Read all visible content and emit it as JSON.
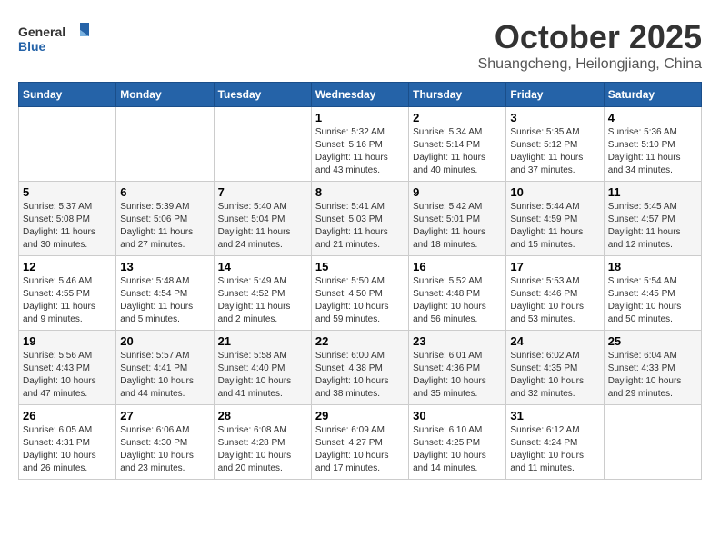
{
  "header": {
    "logo_line1": "General",
    "logo_line2": "Blue",
    "month": "October 2025",
    "location": "Shuangcheng, Heilongjiang, China"
  },
  "days_of_week": [
    "Sunday",
    "Monday",
    "Tuesday",
    "Wednesday",
    "Thursday",
    "Friday",
    "Saturday"
  ],
  "weeks": [
    [
      {
        "day": "",
        "info": ""
      },
      {
        "day": "",
        "info": ""
      },
      {
        "day": "",
        "info": ""
      },
      {
        "day": "1",
        "info": "Sunrise: 5:32 AM\nSunset: 5:16 PM\nDaylight: 11 hours\nand 43 minutes."
      },
      {
        "day": "2",
        "info": "Sunrise: 5:34 AM\nSunset: 5:14 PM\nDaylight: 11 hours\nand 40 minutes."
      },
      {
        "day": "3",
        "info": "Sunrise: 5:35 AM\nSunset: 5:12 PM\nDaylight: 11 hours\nand 37 minutes."
      },
      {
        "day": "4",
        "info": "Sunrise: 5:36 AM\nSunset: 5:10 PM\nDaylight: 11 hours\nand 34 minutes."
      }
    ],
    [
      {
        "day": "5",
        "info": "Sunrise: 5:37 AM\nSunset: 5:08 PM\nDaylight: 11 hours\nand 30 minutes."
      },
      {
        "day": "6",
        "info": "Sunrise: 5:39 AM\nSunset: 5:06 PM\nDaylight: 11 hours\nand 27 minutes."
      },
      {
        "day": "7",
        "info": "Sunrise: 5:40 AM\nSunset: 5:04 PM\nDaylight: 11 hours\nand 24 minutes."
      },
      {
        "day": "8",
        "info": "Sunrise: 5:41 AM\nSunset: 5:03 PM\nDaylight: 11 hours\nand 21 minutes."
      },
      {
        "day": "9",
        "info": "Sunrise: 5:42 AM\nSunset: 5:01 PM\nDaylight: 11 hours\nand 18 minutes."
      },
      {
        "day": "10",
        "info": "Sunrise: 5:44 AM\nSunset: 4:59 PM\nDaylight: 11 hours\nand 15 minutes."
      },
      {
        "day": "11",
        "info": "Sunrise: 5:45 AM\nSunset: 4:57 PM\nDaylight: 11 hours\nand 12 minutes."
      }
    ],
    [
      {
        "day": "12",
        "info": "Sunrise: 5:46 AM\nSunset: 4:55 PM\nDaylight: 11 hours\nand 9 minutes."
      },
      {
        "day": "13",
        "info": "Sunrise: 5:48 AM\nSunset: 4:54 PM\nDaylight: 11 hours\nand 5 minutes."
      },
      {
        "day": "14",
        "info": "Sunrise: 5:49 AM\nSunset: 4:52 PM\nDaylight: 11 hours\nand 2 minutes."
      },
      {
        "day": "15",
        "info": "Sunrise: 5:50 AM\nSunset: 4:50 PM\nDaylight: 10 hours\nand 59 minutes."
      },
      {
        "day": "16",
        "info": "Sunrise: 5:52 AM\nSunset: 4:48 PM\nDaylight: 10 hours\nand 56 minutes."
      },
      {
        "day": "17",
        "info": "Sunrise: 5:53 AM\nSunset: 4:46 PM\nDaylight: 10 hours\nand 53 minutes."
      },
      {
        "day": "18",
        "info": "Sunrise: 5:54 AM\nSunset: 4:45 PM\nDaylight: 10 hours\nand 50 minutes."
      }
    ],
    [
      {
        "day": "19",
        "info": "Sunrise: 5:56 AM\nSunset: 4:43 PM\nDaylight: 10 hours\nand 47 minutes."
      },
      {
        "day": "20",
        "info": "Sunrise: 5:57 AM\nSunset: 4:41 PM\nDaylight: 10 hours\nand 44 minutes."
      },
      {
        "day": "21",
        "info": "Sunrise: 5:58 AM\nSunset: 4:40 PM\nDaylight: 10 hours\nand 41 minutes."
      },
      {
        "day": "22",
        "info": "Sunrise: 6:00 AM\nSunset: 4:38 PM\nDaylight: 10 hours\nand 38 minutes."
      },
      {
        "day": "23",
        "info": "Sunrise: 6:01 AM\nSunset: 4:36 PM\nDaylight: 10 hours\nand 35 minutes."
      },
      {
        "day": "24",
        "info": "Sunrise: 6:02 AM\nSunset: 4:35 PM\nDaylight: 10 hours\nand 32 minutes."
      },
      {
        "day": "25",
        "info": "Sunrise: 6:04 AM\nSunset: 4:33 PM\nDaylight: 10 hours\nand 29 minutes."
      }
    ],
    [
      {
        "day": "26",
        "info": "Sunrise: 6:05 AM\nSunset: 4:31 PM\nDaylight: 10 hours\nand 26 minutes."
      },
      {
        "day": "27",
        "info": "Sunrise: 6:06 AM\nSunset: 4:30 PM\nDaylight: 10 hours\nand 23 minutes."
      },
      {
        "day": "28",
        "info": "Sunrise: 6:08 AM\nSunset: 4:28 PM\nDaylight: 10 hours\nand 20 minutes."
      },
      {
        "day": "29",
        "info": "Sunrise: 6:09 AM\nSunset: 4:27 PM\nDaylight: 10 hours\nand 17 minutes."
      },
      {
        "day": "30",
        "info": "Sunrise: 6:10 AM\nSunset: 4:25 PM\nDaylight: 10 hours\nand 14 minutes."
      },
      {
        "day": "31",
        "info": "Sunrise: 6:12 AM\nSunset: 4:24 PM\nDaylight: 10 hours\nand 11 minutes."
      },
      {
        "day": "",
        "info": ""
      }
    ]
  ]
}
